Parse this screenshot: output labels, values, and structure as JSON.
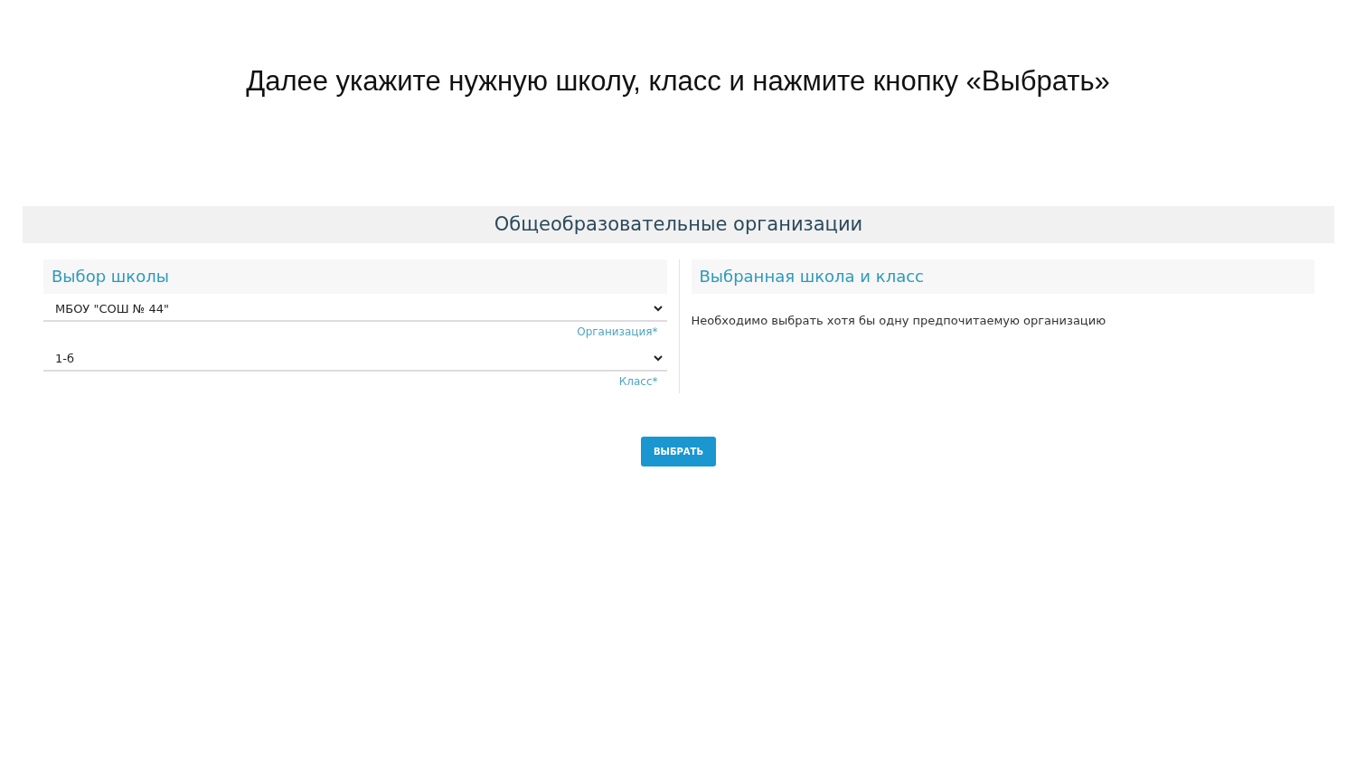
{
  "instruction": "Далее укажите нужную школу, класс и нажмите кнопку «Выбрать»",
  "header": {
    "title": "Общеобразовательные организации"
  },
  "left_panel": {
    "title": "Выбор школы",
    "fields": [
      {
        "value": "МБОУ \"СОШ № 44\"",
        "label": "Организация*"
      },
      {
        "value": "1-б",
        "label": "Класс*"
      }
    ]
  },
  "right_panel": {
    "title": "Выбранная школа и класс",
    "message": "Необходимо выбрать хотя бы одну предпочитаемую организацию"
  },
  "button": "ВЫБРАТЬ"
}
